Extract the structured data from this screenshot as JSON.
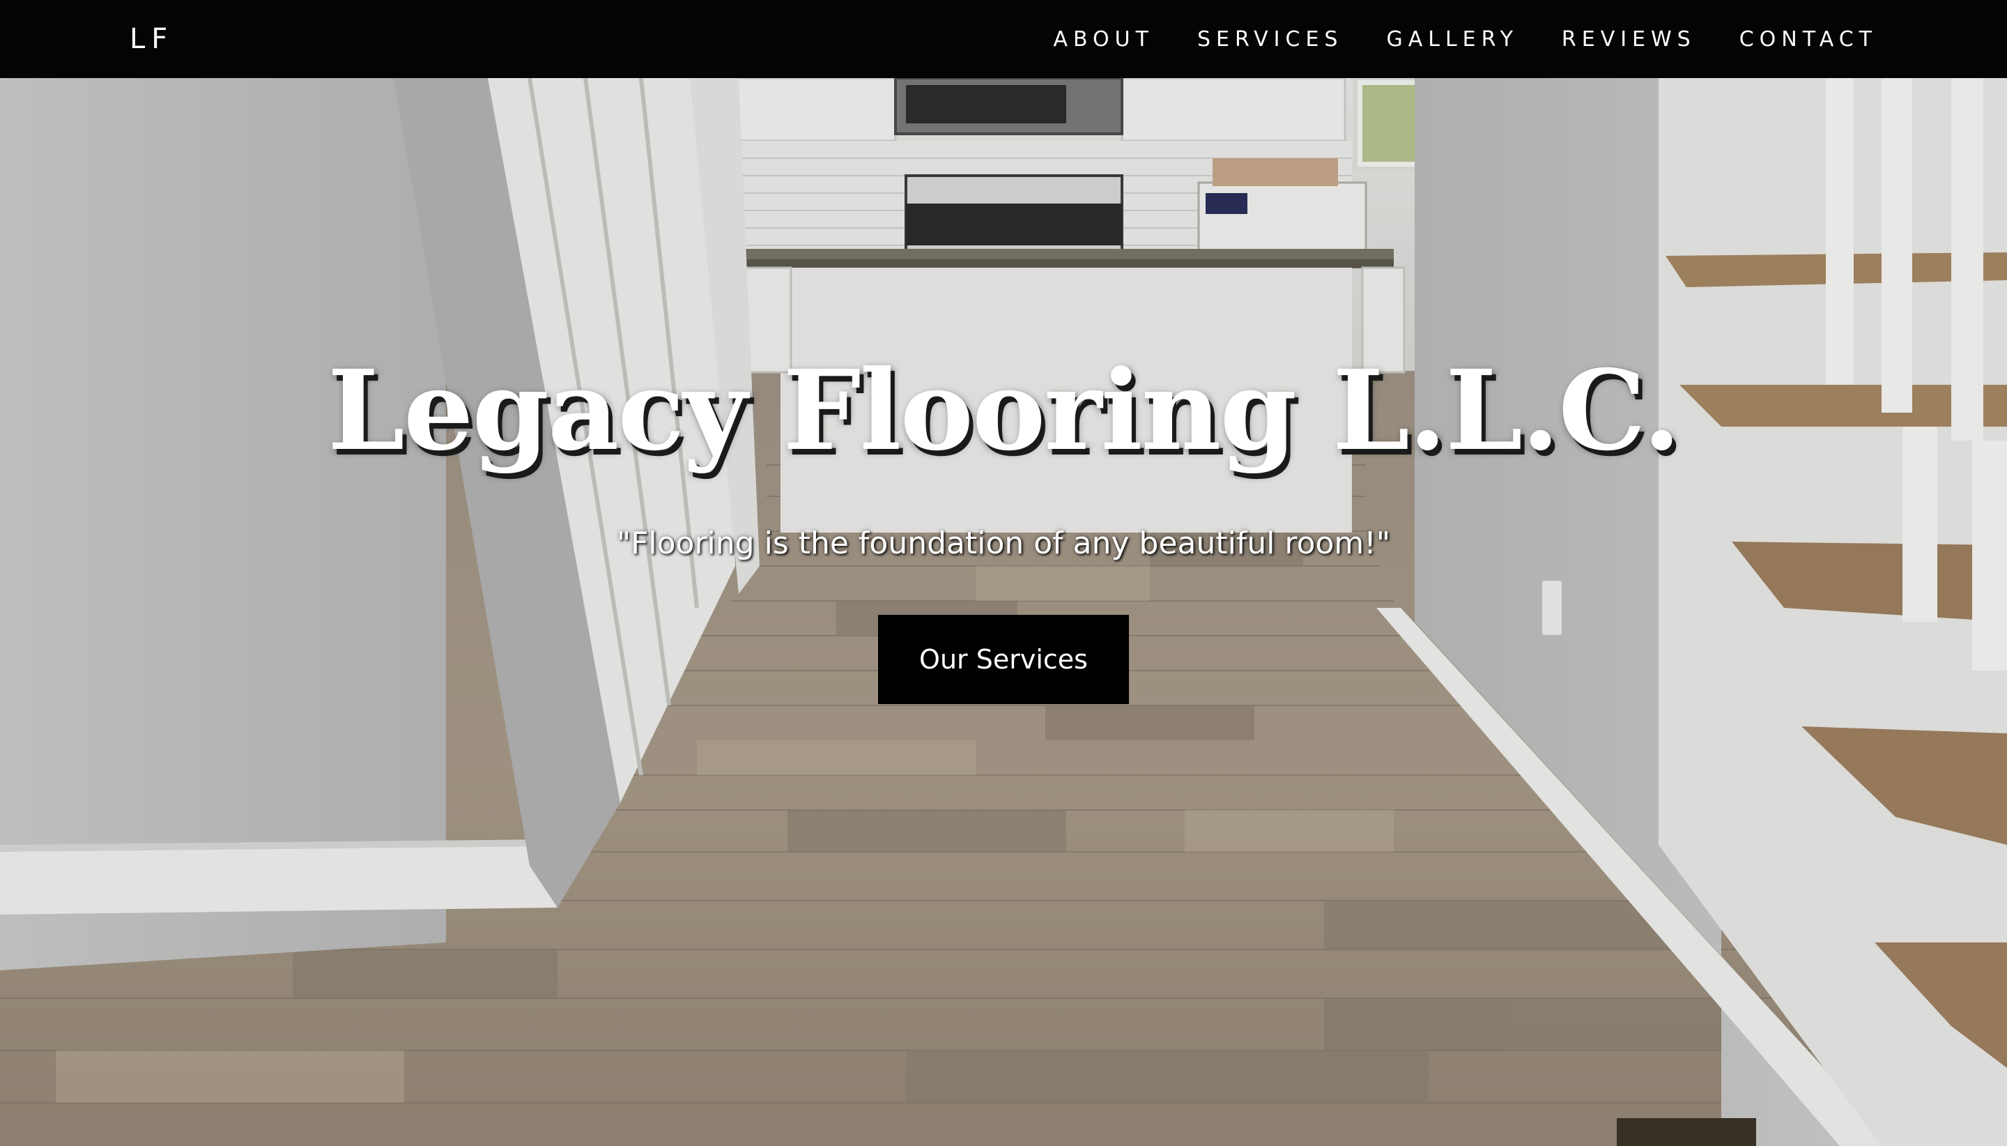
{
  "header": {
    "logo": "LF",
    "nav": [
      {
        "label": "ABOUT"
      },
      {
        "label": "SERVICES"
      },
      {
        "label": "GALLERY"
      },
      {
        "label": "REVIEWS"
      },
      {
        "label": "CONTACT"
      }
    ]
  },
  "hero": {
    "title": "Legacy Flooring L.L.C.",
    "tagline": "\"Flooring is the foundation of any beautiful room!\"",
    "cta_label": "Our Services",
    "background_image": "hardwood-floor-hallway-photo"
  },
  "colors": {
    "nav_background": "#040404",
    "nav_text": "#ffffff",
    "button_background": "#000000",
    "button_text": "#ffffff",
    "title_text": "#ffffff"
  }
}
